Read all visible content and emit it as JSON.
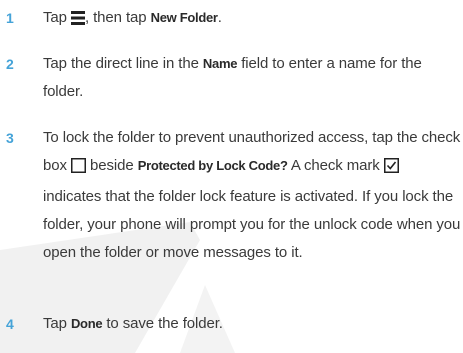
{
  "steps": [
    {
      "number": "1",
      "pre": "Tap",
      "icon": "menu-icon",
      "mid": ", then tap",
      "ui_label": "New Folder",
      "post": "."
    },
    {
      "number": "2",
      "pre": "Tap the direct line in the",
      "ui_label": "Name",
      "post": "field to enter a name for the folder."
    },
    {
      "number": "3",
      "pre": "To lock the folder to prevent unauthorized access, tap the check box",
      "checkbox_icon": "empty-checkbox-icon",
      "mid": "beside",
      "ui_label": "Protected by Lock Code?",
      "mid2": "A check mark",
      "checkmark_icon": "checked-checkbox-icon",
      "post": "indicates that the folder lock feature is activated. If you lock the folder, your phone will prompt you for the unlock code when you open the folder or move messages to it."
    },
    {
      "number": "4",
      "pre": "Tap",
      "ui_label": "Done",
      "post": "to save the folder."
    }
  ],
  "colors": {
    "step_number": "#45a3d8",
    "body_text": "#3a3a3a",
    "watermark": "#f1f1f1"
  }
}
